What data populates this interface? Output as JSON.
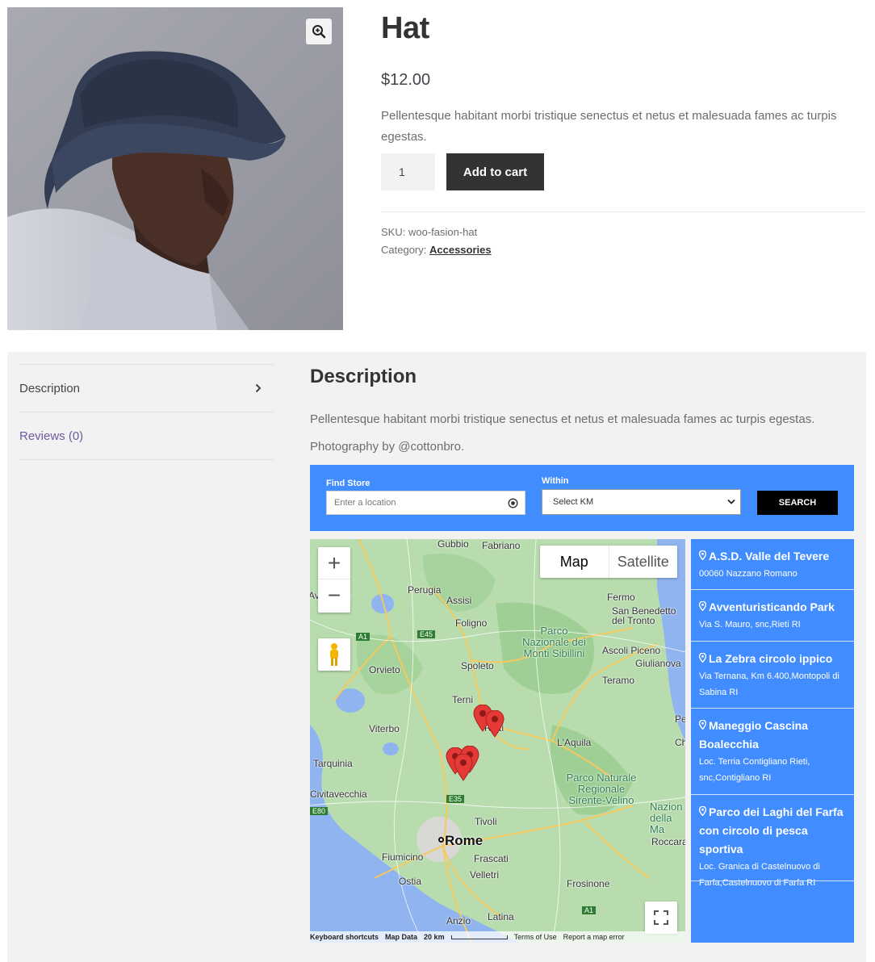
{
  "product": {
    "title": "Hat",
    "price": "$12.00",
    "short_description": "Pellentesque habitant morbi tristique senectus et netus et malesuada fames ac turpis egestas.",
    "quantity": "1",
    "add_to_cart_label": "Add to cart",
    "sku_label": "SKU:",
    "sku": "woo-fasion-hat",
    "category_label": "Category:",
    "category": "Accessories"
  },
  "tabs": [
    {
      "label": "Description"
    },
    {
      "label": "Reviews (0)"
    }
  ],
  "description": {
    "heading": "Description",
    "paragraph": "Pellentesque habitant morbi tristique senectus et netus et malesuada fames ac turpis egestas.",
    "credit": "Photography by @cottonbro."
  },
  "locator": {
    "find_label": "Find Store",
    "location_placeholder": "Enter a location",
    "within_label": "Within",
    "distance_selected": "Select KM",
    "search_label": "SEARCH",
    "accent_color": "#418cff"
  },
  "map": {
    "type_map": "Map",
    "type_satellite": "Satellite",
    "zoom_in": "+",
    "zoom_out": "−",
    "places": [
      "Gubbio",
      "Fabriano",
      "Perugia",
      "Assisi",
      "Foligno",
      "Parco Nazionale dei Monti Sibillini",
      "Fermo",
      "San Benedetto del Tronto",
      "Ascoli Piceno",
      "Giulianova",
      "Orvieto",
      "Spoleto",
      "Teramo",
      "Terni",
      "Viterbo",
      "Rieti",
      "L'Aquila",
      "Tarquinia",
      "Parco Naturale Regionale Sirente-Velino",
      "Civitavecchia",
      "Rome",
      "Tivoli",
      "Fiumicino",
      "Frascati",
      "Velletri",
      "Ostia",
      "Frosinone",
      "Anzio",
      "Latina",
      "Avezzano",
      "Roccara",
      "Nazion della Ma",
      "Pe",
      "Ch"
    ],
    "attribution": {
      "shortcuts": "Keyboard shortcuts",
      "map_data": "Map Data",
      "scale": "20 km",
      "terms": "Terms of Use",
      "report": "Report a map error"
    },
    "roads": [
      "A1",
      "E45",
      "E35",
      "E80",
      "A1"
    ]
  },
  "stores": [
    {
      "name": "A.S.D. Valle del Tevere",
      "address": "00060 Nazzano Romano"
    },
    {
      "name": "Avventuristicando Park",
      "address": "Via S. Mauro, snc,Rieti RI"
    },
    {
      "name": "La Zebra circolo ippico",
      "address": "Via Ternana, Km 6.400,Montopoli di Sabina RI"
    },
    {
      "name": "Maneggio Cascina Boalecchia",
      "address": "Loc. Terria Contigliano Rieti, snc,Contigliano RI"
    },
    {
      "name": "Parco dei Laghi del Farfa con circolo di pesca sportiva",
      "address": "Loc. Granica di Castelnuovo di Farfa,Castelnuovo di Farfa RI"
    }
  ]
}
